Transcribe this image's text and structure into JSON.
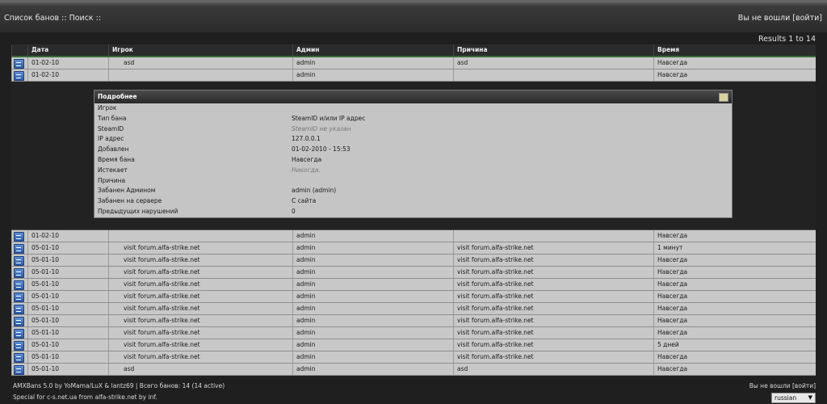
{
  "topbar": {
    "crumb_bans": "Список банов",
    "sep1": " :: ",
    "crumb_search": "Поиск",
    "sep2": " ::",
    "login_status": "Вы не вошли [войти]"
  },
  "results_label": "Results 1 to 14",
  "table": {
    "headers": [
      "Дата",
      "Игрок",
      "Админ",
      "Причина",
      "Время"
    ],
    "rows_top": [
      {
        "date": "01-02-10",
        "player": "asd",
        "admin": "admin",
        "reason": "asd",
        "time": "Навсегда"
      },
      {
        "date": "01-02-10",
        "player": "",
        "admin": "admin",
        "reason": "",
        "time": "Навсегда"
      }
    ],
    "rows_bottom": [
      {
        "date": "01-02-10",
        "player": "",
        "admin": "admin",
        "reason": "",
        "time": "Навсегда"
      },
      {
        "date": "05-01-10",
        "player": "visit forum.alfa-strike.net",
        "admin": "admin",
        "reason": "visit forum.alfa-strike.net",
        "time": "1 минут"
      },
      {
        "date": "05-01-10",
        "player": "visit forum.alfa-strike.net",
        "admin": "admin",
        "reason": "visit forum.alfa-strike.net",
        "time": "Навсегда"
      },
      {
        "date": "05-01-10",
        "player": "visit forum.alfa-strike.net",
        "admin": "admin",
        "reason": "visit forum.alfa-strike.net",
        "time": "Навсегда"
      },
      {
        "date": "05-01-10",
        "player": "visit forum.alfa-strike.net",
        "admin": "admin",
        "reason": "visit forum.alfa-strike.net",
        "time": "Навсегда"
      },
      {
        "date": "05-01-10",
        "player": "visit forum.alfa-strike.net",
        "admin": "admin",
        "reason": "visit forum.alfa-strike.net",
        "time": "Навсегда"
      },
      {
        "date": "05-01-10",
        "player": "visit forum.alfa-strike.net",
        "admin": "admin",
        "reason": "visit forum.alfa-strike.net",
        "time": "Навсегда"
      },
      {
        "date": "05-01-10",
        "player": "visit forum.alfa-strike.net",
        "admin": "admin",
        "reason": "visit forum.alfa-strike.net",
        "time": "Навсегда"
      },
      {
        "date": "05-01-10",
        "player": "visit forum.alfa-strike.net",
        "admin": "admin",
        "reason": "visit forum.alfa-strike.net",
        "time": "Навсегда"
      },
      {
        "date": "05-01-10",
        "player": "visit forum.alfa-strike.net",
        "admin": "admin",
        "reason": "visit forum.alfa-strike.net",
        "time": "5 дней"
      },
      {
        "date": "05-01-10",
        "player": "visit forum.alfa-strike.net",
        "admin": "admin",
        "reason": "visit forum.alfa-strike.net",
        "time": "Навсегда"
      },
      {
        "date": "05-01-10",
        "player": "asd",
        "admin": "admin",
        "reason": "asd",
        "time": "Навсегда"
      }
    ]
  },
  "details": {
    "title": "Подробнее",
    "fields": [
      {
        "k": "Игрок",
        "v": ""
      },
      {
        "k": "Тип бана",
        "v": "SteamID и/или IP адрес"
      },
      {
        "k": "SteamID",
        "v": "SteamID не указан",
        "muted": true
      },
      {
        "k": "IP адрес",
        "v": "127.0.0.1"
      },
      {
        "k": "Добавлен",
        "v": "01-02-2010 - 15:53"
      },
      {
        "k": "Время бана",
        "v": "Навсегда"
      },
      {
        "k": "Истекает",
        "v": "Никогда.",
        "muted": true
      },
      {
        "k": "Причина",
        "v": ""
      },
      {
        "k": "Забанен Админом",
        "v": "admin (admin)"
      },
      {
        "k": "Забанен на сервере",
        "v": "С сайта"
      },
      {
        "k": "Предыдущих нарушений",
        "v": "0"
      }
    ]
  },
  "footer": {
    "line1": "AMXBans 5.0 by YoMama/LuX & lantz69 | Всего банов: 14 (14 active)",
    "line2": "Special for c-s.net.ua from alfa-strike.net by inf.",
    "login_status": "Вы не вошли [войти]",
    "language": "russian"
  },
  "icons": {
    "row_icon": "details-icon",
    "details_close": "close-details-icon"
  }
}
